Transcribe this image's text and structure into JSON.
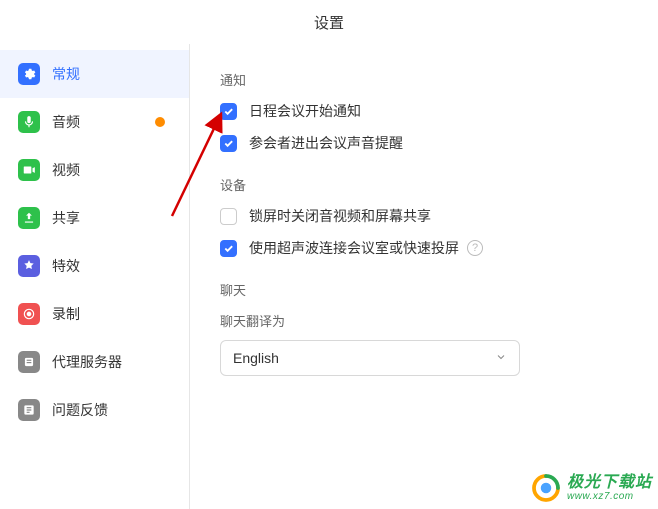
{
  "header": {
    "title": "设置"
  },
  "sidebar": {
    "items": [
      {
        "label": "常规",
        "icon": "gear-icon",
        "color": "#3370ff",
        "active": true
      },
      {
        "label": "音频",
        "icon": "mic-icon",
        "color": "#2ec14b",
        "badge": true
      },
      {
        "label": "视频",
        "icon": "video-icon",
        "color": "#2ec14b"
      },
      {
        "label": "共享",
        "icon": "share-icon",
        "color": "#2ec14b"
      },
      {
        "label": "特效",
        "icon": "effects-icon",
        "color": "#5b5fe0"
      },
      {
        "label": "录制",
        "icon": "record-icon",
        "color": "#f05151"
      },
      {
        "label": "代理服务器",
        "icon": "proxy-icon",
        "color": "#888"
      },
      {
        "label": "问题反馈",
        "icon": "feedback-icon",
        "color": "#888"
      }
    ]
  },
  "content": {
    "sections": {
      "notifications": {
        "title": "通知",
        "items": [
          {
            "label": "日程会议开始通知",
            "checked": true
          },
          {
            "label": "参会者进出会议声音提醒",
            "checked": true
          }
        ]
      },
      "device": {
        "title": "设备",
        "items": [
          {
            "label": "锁屏时关闭音视频和屏幕共享",
            "checked": false
          },
          {
            "label": "使用超声波连接会议室或快速投屏",
            "checked": true,
            "help": true
          }
        ]
      },
      "chat": {
        "title": "聊天",
        "translate_label": "聊天翻译为",
        "selected_language": "English"
      }
    }
  },
  "watermark": {
    "cn": "极光下载站",
    "url": "www.xz7.com"
  }
}
